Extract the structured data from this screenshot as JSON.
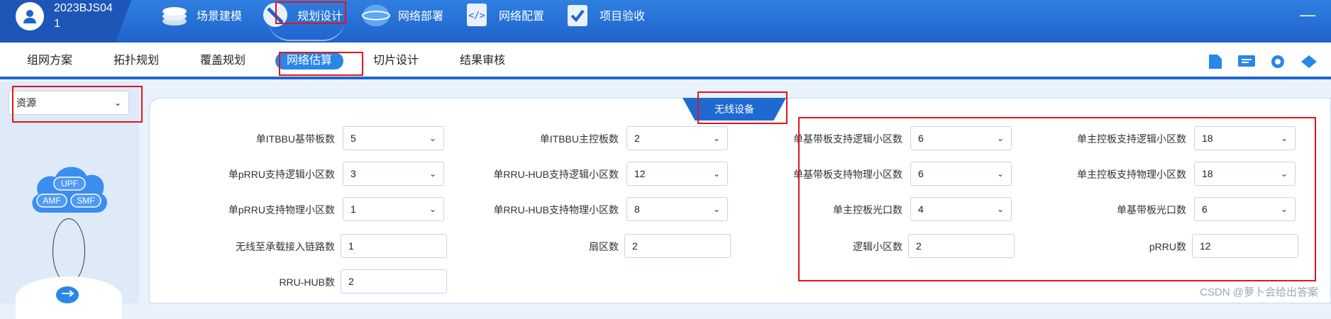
{
  "user": {
    "name": "2023BJS041"
  },
  "main_nav": [
    {
      "label": "场景建模",
      "icon": "layers-icon"
    },
    {
      "label": "规划设计",
      "icon": "compass-icon",
      "active": true
    },
    {
      "label": "网络部署",
      "icon": "globe-icon"
    },
    {
      "label": "网络配置",
      "icon": "code-doc-icon"
    },
    {
      "label": "项目验收",
      "icon": "checklist-icon"
    }
  ],
  "minimize": "—",
  "sub_tabs": [
    {
      "label": "组网方案"
    },
    {
      "label": "拓扑规划"
    },
    {
      "label": "覆盖规划"
    },
    {
      "label": "网络估算",
      "active": true
    },
    {
      "label": "切片设计"
    },
    {
      "label": "结果审核"
    }
  ],
  "left": {
    "resource_select": "资源",
    "cloud_labels": [
      "UPF",
      "AMF",
      "SMF"
    ]
  },
  "section_title": "无线设备",
  "form": {
    "col1": [
      {
        "label": "单ITBBU基带板数",
        "value": "5",
        "type": "select"
      },
      {
        "label": "单pRRU支持逻辑小区数",
        "value": "3",
        "type": "select"
      },
      {
        "label": "单pRRU支持物理小区数",
        "value": "1",
        "type": "select"
      },
      {
        "label": "无线至承载接入链路数",
        "value": "1",
        "type": "input"
      },
      {
        "label": "RRU-HUB数",
        "value": "2",
        "type": "input"
      }
    ],
    "col2": [
      {
        "label": "单ITBBU主控板数",
        "value": "2",
        "type": "select"
      },
      {
        "label": "单RRU-HUB支持逻辑小区数",
        "value": "12",
        "type": "select"
      },
      {
        "label": "单RRU-HUB支持物理小区数",
        "value": "8",
        "type": "select"
      },
      {
        "label": "扇区数",
        "value": "2",
        "type": "input"
      }
    ],
    "col3": [
      {
        "label": "单基带板支持逻辑小区数",
        "value": "6",
        "type": "select"
      },
      {
        "label": "单基带板支持物理小区数",
        "value": "6",
        "type": "select"
      },
      {
        "label": "单主控板光口数",
        "value": "4",
        "type": "select"
      },
      {
        "label": "逻辑小区数",
        "value": "2",
        "type": "input"
      }
    ],
    "col4": [
      {
        "label": "单主控板支持逻辑小区数",
        "value": "18",
        "type": "select"
      },
      {
        "label": "单主控板支持物理小区数",
        "value": "18",
        "type": "select"
      },
      {
        "label": "单基带板光口数",
        "value": "6",
        "type": "select"
      },
      {
        "label": "pRRU数",
        "value": "12",
        "type": "input"
      }
    ]
  },
  "watermark": "CSDN @萝卜会给出答案",
  "colors": {
    "brand": "#1f63cc",
    "accent": "#2a86e8",
    "highlight": "#e0161b"
  }
}
